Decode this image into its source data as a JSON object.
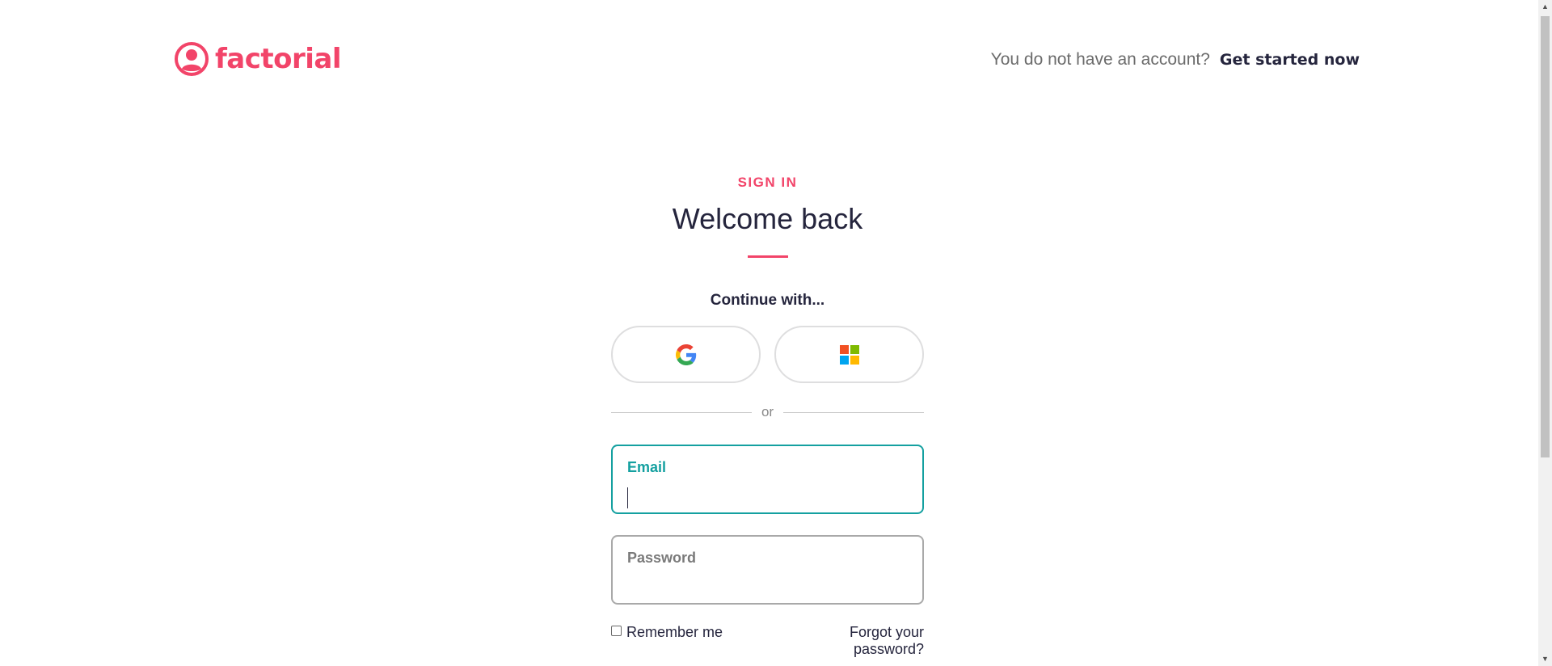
{
  "header": {
    "logo_text": "factorial",
    "account_prompt": "You do not have an account?",
    "get_started_label": "Get started now"
  },
  "form": {
    "eyebrow": "SIGN IN",
    "title": "Welcome back",
    "continue_label": "Continue with...",
    "sso": [
      {
        "provider": "google",
        "icon": "google-icon"
      },
      {
        "provider": "microsoft",
        "icon": "microsoft-icon"
      }
    ],
    "divider_text": "or",
    "email": {
      "label": "Email",
      "value": ""
    },
    "password": {
      "label": "Password",
      "value": ""
    },
    "remember_label": "Remember me",
    "forgot_label": "Forgot your password?"
  },
  "colors": {
    "brand": "#f24469",
    "focus": "#14a0a0",
    "text": "#25253d"
  }
}
